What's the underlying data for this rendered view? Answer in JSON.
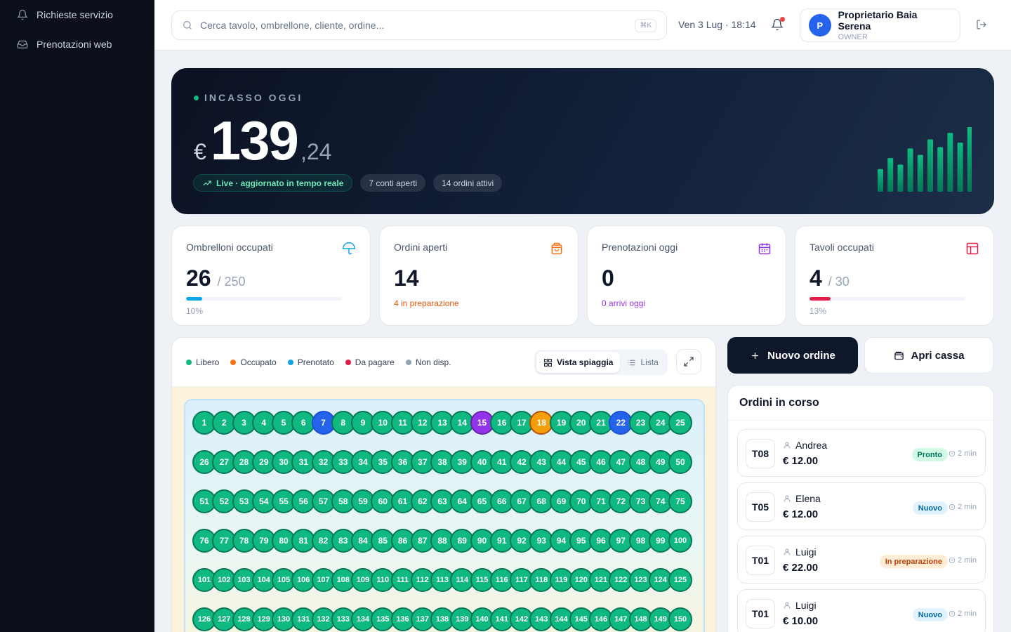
{
  "sidebar": {
    "items": [
      {
        "label": "Richieste servizio",
        "icon": "bell-icon"
      },
      {
        "label": "Prenotazioni web",
        "icon": "inbox-icon"
      }
    ]
  },
  "header": {
    "search_placeholder": "Cerca tavolo, ombrellone, cliente, ordine...",
    "search_shortcut": "⌘K",
    "datetime": "Ven 3 Lug · 18:14",
    "user": {
      "initial": "P",
      "name": "Proprietario Baia Serena",
      "role": "OWNER"
    }
  },
  "hero": {
    "label": "INCASSO OGGI",
    "currency": "€",
    "integer": "139",
    "decimals": ",24",
    "live_label": "Live · aggiornato in tempo reale",
    "open_accounts": "7 conti aperti",
    "active_orders": "14 ordini attivi",
    "bars": [
      0.35,
      0.52,
      0.42,
      0.67,
      0.57,
      0.81,
      0.69,
      0.91,
      0.76,
      1.0
    ],
    "colors": {
      "accent": "#10b981"
    }
  },
  "stats": [
    {
      "title": "Ombrelloni occupati",
      "value": "26",
      "total": "/ 250",
      "pct_label": "10%",
      "fraction": 0.104,
      "color": "#0ea5e9",
      "icon": "umbrella-icon"
    },
    {
      "title": "Ordini aperti",
      "value": "14",
      "sub": "4 in preparazione",
      "color": "#f97316",
      "icon": "shopping-bag-icon"
    },
    {
      "title": "Prenotazioni oggi",
      "value": "0",
      "sub": "0 arrivi oggi",
      "color": "#9333ea",
      "icon": "calendar-icon"
    },
    {
      "title": "Tavoli occupati",
      "value": "4",
      "total": "/ 30",
      "pct_label": "13%",
      "fraction": 0.133,
      "color": "#e11d48",
      "icon": "table-icon"
    }
  ],
  "map": {
    "legend": [
      {
        "label": "Libero",
        "color": "#10b981"
      },
      {
        "label": "Occupato",
        "color": "#f97316"
      },
      {
        "label": "Prenotato",
        "color": "#0ea5e9"
      },
      {
        "label": "Da pagare",
        "color": "#e11d48"
      },
      {
        "label": "Non disp.",
        "color": "#94a3b8"
      }
    ],
    "view_beach": "Vista spiaggia",
    "view_list": "Lista",
    "umbrellas": {
      "first": 1,
      "last": 150,
      "per_row": 25,
      "status_colors": {
        "free": "#10b981",
        "blue": "#2563eb",
        "purple": "#9333ea",
        "orange": "#f59e0b"
      },
      "special": {
        "7": "blue",
        "15": "purple",
        "18": "orange",
        "22": "blue"
      }
    }
  },
  "actions": {
    "new_order": "Nuovo ordine",
    "open_register": "Apri cassa"
  },
  "orders": {
    "title": "Ordini in corso",
    "items": [
      {
        "table": "T08",
        "name": "Andrea",
        "price": "€ 12.00",
        "status": "Pronto",
        "status_bg": "#d1fae5",
        "status_fg": "#047857",
        "time": "2 min"
      },
      {
        "table": "T05",
        "name": "Elena",
        "price": "€ 12.00",
        "status": "Nuovo",
        "status_bg": "#e0f2fe",
        "status_fg": "#0369a1",
        "time": "2 min"
      },
      {
        "table": "T01",
        "name": "Luigi",
        "price": "€ 22.00",
        "status": "In preparazione",
        "status_bg": "#ffedd5",
        "status_fg": "#c2410c",
        "time": "2 min"
      },
      {
        "table": "T01",
        "name": "Luigi",
        "price": "€ 10.00",
        "status": "Nuovo",
        "status_bg": "#e0f2fe",
        "status_fg": "#0369a1",
        "time": "2 min"
      }
    ]
  }
}
